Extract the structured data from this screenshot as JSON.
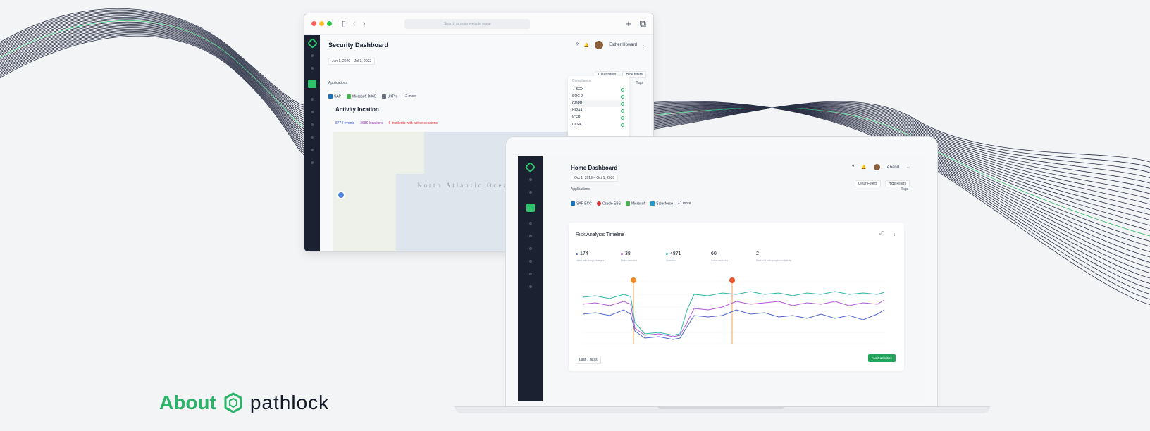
{
  "colors": {
    "accent": "#2dc26b",
    "sidebar": "#1c2132",
    "series_1": "#2bb6a3",
    "series_2": "#b157d6",
    "series_3": "#4b63c9",
    "marker": "#f08a28"
  },
  "back_window": {
    "url_placeholder": "Search or enter website name",
    "title": "Security Dashboard",
    "user_name": "Esther Howard",
    "date_range": "Jun 1, 2020  –  Jul 3, 2022",
    "applications_label": "Applications",
    "clear_filters": "Clear filters",
    "hide_filters": "Hide filters",
    "tags_label": "Tags",
    "apps": [
      "SAP",
      "Microsoft D365",
      "UKPro",
      "+2 more"
    ],
    "section_title": "Activity location",
    "chips": [
      "8774 events",
      "3686 locations",
      "6 incidents with active sessions"
    ],
    "map_ocean": "North Atlantic Ocean",
    "compliance": {
      "header": "Compliance",
      "items": [
        "SOX",
        "SOC 2",
        "GDPR",
        "HIPAA",
        "ICFR",
        "CCPA"
      ]
    }
  },
  "home": {
    "title": "Home Dashboard",
    "user_name": "Anand",
    "date_range": "Oct 1, 2019 – Oct 1, 2020",
    "applications_label": "Applications",
    "clear_filters": "Clear Filters",
    "hide_filters": "Hide Filters",
    "tags_label": "Tags",
    "apps": [
      "SAP ECC",
      "Oracle EBS",
      "Microsoft",
      "Salesforce",
      "+1 more"
    ],
    "card": {
      "title": "Risk Analysis Timeline",
      "stats": [
        {
          "value": "174",
          "label": "Users with risky privileges"
        },
        {
          "value": "38",
          "label": "Risks detected"
        },
        {
          "value": "4871",
          "label": "Violations"
        },
        {
          "value": "60",
          "label": "Active sessions"
        },
        {
          "value": "2",
          "label": "Sessions with suspicious activity"
        }
      ],
      "period": "Last 7 days",
      "action": "Audit activities"
    }
  },
  "about": {
    "word": "About",
    "brand": "pathlock"
  }
}
